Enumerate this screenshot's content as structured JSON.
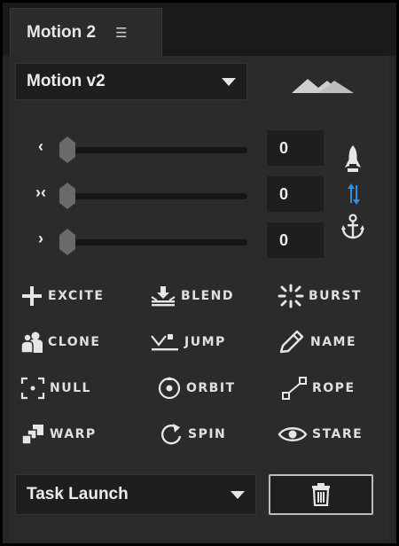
{
  "tab": {
    "title": "Motion 2",
    "menu_glyph": "☰"
  },
  "preset_dropdown": {
    "selected": "Motion v2"
  },
  "sliders": [
    {
      "glyph": "‹",
      "value": "0",
      "position": 0
    },
    {
      "glyph": "›‹",
      "value": "0",
      "position": 0
    },
    {
      "glyph": "›",
      "value": "0",
      "position": 0
    }
  ],
  "side_icons": [
    "rocket-icon",
    "arrows-updown-icon",
    "anchor-icon"
  ],
  "actions": [
    {
      "id": "excite",
      "label": "EXCITE",
      "icon": "plus-icon"
    },
    {
      "id": "blend",
      "label": "BLEND",
      "icon": "blend-icon"
    },
    {
      "id": "burst",
      "label": "BURST",
      "icon": "burst-icon"
    },
    {
      "id": "clone",
      "label": "CLONE",
      "icon": "clone-icon"
    },
    {
      "id": "jump",
      "label": "JUMP",
      "icon": "jump-icon"
    },
    {
      "id": "name",
      "label": "NAME",
      "icon": "pencil-icon"
    },
    {
      "id": "null",
      "label": "NULL",
      "icon": "null-icon"
    },
    {
      "id": "orbit",
      "label": "ORBIT",
      "icon": "orbit-icon"
    },
    {
      "id": "rope",
      "label": "ROPE",
      "icon": "rope-icon"
    },
    {
      "id": "warp",
      "label": "WARP",
      "icon": "warp-icon"
    },
    {
      "id": "spin",
      "label": "SPIN",
      "icon": "spin-icon"
    },
    {
      "id": "stare",
      "label": "STARE",
      "icon": "eye-icon"
    }
  ],
  "task_dropdown": {
    "selected": "Task Launch"
  },
  "colors": {
    "panel": "#2b2b2b",
    "accent_blue": "#2f8fe0",
    "text": "#ececec"
  }
}
